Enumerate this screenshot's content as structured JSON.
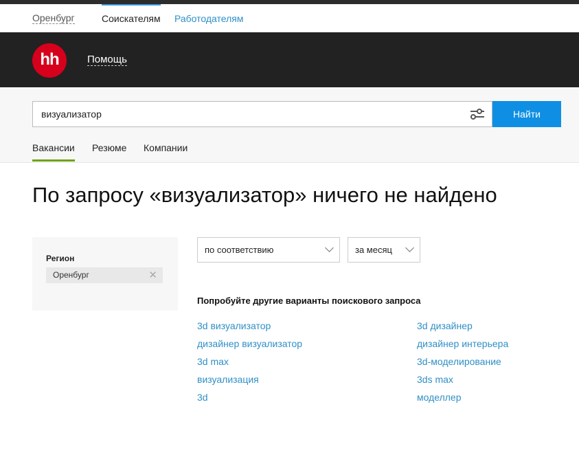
{
  "topnav": {
    "city": "Оренбург",
    "seekers": "Соискателям",
    "employers": "Работодателям"
  },
  "header": {
    "logo": "hh",
    "help": "Помощь"
  },
  "search": {
    "value": "визуализатор",
    "button": "Найти"
  },
  "tabs": [
    "Вакансии",
    "Резюме",
    "Компании"
  ],
  "title": "По запросу «визуализатор» ничего не найдено",
  "sidebar": {
    "region_label": "Регион",
    "region_chip": "Оренбург"
  },
  "sort": {
    "order": "по соответствию",
    "period": "за месяц"
  },
  "suggestions": {
    "heading": "Попробуйте другие варианты поискового запроса",
    "left": [
      "3d визуализатор",
      "дизайнер визуализатор",
      "3d max",
      "визуализация",
      "3d"
    ],
    "right": [
      "3d дизайнер",
      "дизайнер интерьера",
      "3d-моделирование",
      "3ds max",
      "моделлер"
    ]
  },
  "colors": {
    "accent": "#0f8fe4",
    "brand": "#d6001c",
    "link": "#2f8fc6",
    "tab_active": "#6fa316"
  }
}
